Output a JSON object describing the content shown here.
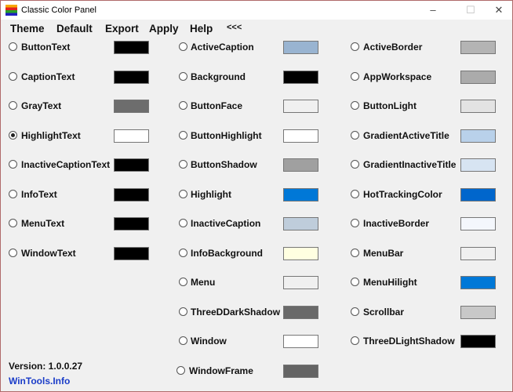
{
  "window": {
    "title": "Classic Color Panel",
    "minimize": "–",
    "maximize": "☐",
    "close": "✕"
  },
  "menu": [
    "Theme",
    "Default",
    "Export",
    "Apply",
    "Help",
    "<<<"
  ],
  "columns": [
    [
      {
        "name": "ButtonText",
        "color": "#000000"
      },
      {
        "name": "CaptionText",
        "color": "#000000"
      },
      {
        "name": "GrayText",
        "color": "#6d6d6d"
      },
      {
        "name": "HighlightText",
        "color": "#ffffff",
        "selected": true
      },
      {
        "name": "InactiveCaptionText",
        "color": "#000000"
      },
      {
        "name": "InfoText",
        "color": "#000000"
      },
      {
        "name": "MenuText",
        "color": "#000000"
      },
      {
        "name": "WindowText",
        "color": "#000000"
      }
    ],
    [
      {
        "name": "ActiveCaption",
        "color": "#99b4d1"
      },
      {
        "name": "Background",
        "color": "#000000"
      },
      {
        "name": "ButtonFace",
        "color": "#f0f0f0"
      },
      {
        "name": "ButtonHighlight",
        "color": "#ffffff"
      },
      {
        "name": "ButtonShadow",
        "color": "#a0a0a0"
      },
      {
        "name": "Highlight",
        "color": "#0078d7"
      },
      {
        "name": "InactiveCaption",
        "color": "#bfcddb"
      },
      {
        "name": "InfoBackground",
        "color": "#ffffe1"
      },
      {
        "name": "Menu",
        "color": "#f0f0f0"
      },
      {
        "name": "ThreeDDarkShadow",
        "color": "#696969"
      },
      {
        "name": "Window",
        "color": "#ffffff"
      },
      {
        "name": "WindowFrame",
        "color": "#646464"
      }
    ],
    [
      {
        "name": "ActiveBorder",
        "color": "#b4b4b4"
      },
      {
        "name": "AppWorkspace",
        "color": "#ababab"
      },
      {
        "name": "ButtonLight",
        "color": "#e3e3e3"
      },
      {
        "name": "GradientActiveTitle",
        "color": "#b9d1ea"
      },
      {
        "name": "GradientInactiveTitle",
        "color": "#d7e4f2"
      },
      {
        "name": "HotTrackingColor",
        "color": "#0066cc"
      },
      {
        "name": "InactiveBorder",
        "color": "#f4f7fc"
      },
      {
        "name": "MenuBar",
        "color": "#f0f0f0"
      },
      {
        "name": "MenuHilight",
        "color": "#0078d7"
      },
      {
        "name": "Scrollbar",
        "color": "#c8c8c8"
      },
      {
        "name": "ThreeDLightShadow",
        "color": "#000000"
      }
    ]
  ],
  "footer": {
    "version": "Version: 1.0.0.27",
    "link": "WinTools.Info"
  }
}
